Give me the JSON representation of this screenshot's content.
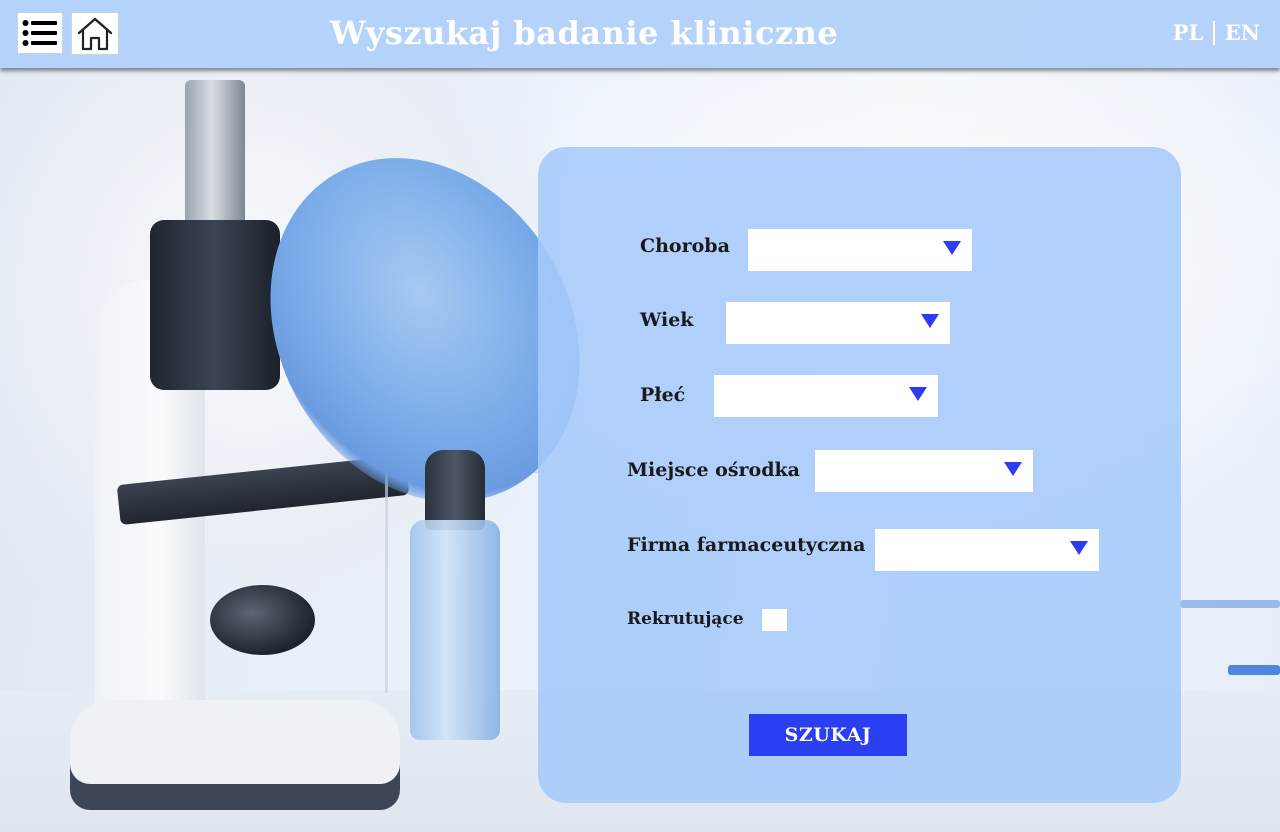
{
  "header": {
    "title": "Wyszukaj badanie kliniczne",
    "menu_icon": "list-icon",
    "home_icon": "home-icon",
    "languages": [
      "PL",
      "EN"
    ]
  },
  "form": {
    "fields": [
      {
        "label": "Choroba",
        "value": ""
      },
      {
        "label": "Wiek",
        "value": ""
      },
      {
        "label": "Płeć",
        "value": ""
      },
      {
        "label": "Miejsce ośrodka",
        "value": ""
      },
      {
        "label": "Firma farmaceutyczna",
        "value": ""
      }
    ],
    "recruiting_label": "Rekrutujące",
    "recruiting_checked": false,
    "search_button": "SZUKAJ"
  },
  "colors": {
    "header_bg": "#b0d0fa",
    "panel_bg": "#a6cafa",
    "accent": "#2a3ff2",
    "arrow": "#2e3cf0"
  }
}
